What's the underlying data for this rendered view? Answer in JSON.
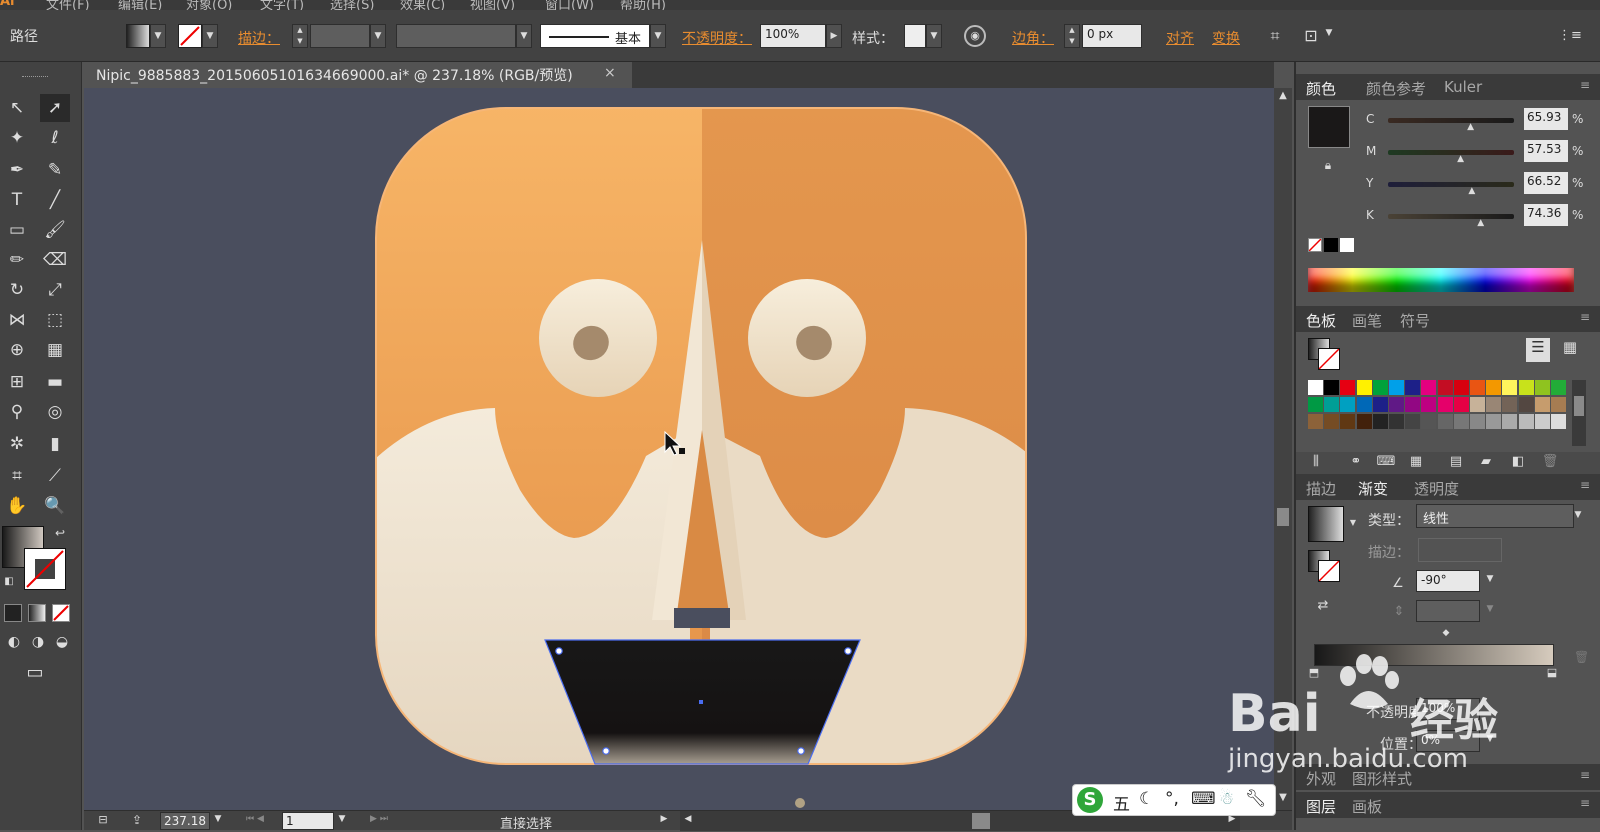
{
  "menu": {
    "items": [
      "文件(F)",
      "编辑(E)",
      "对象(O)",
      "文字(T)",
      "选择(S)",
      "效果(C)",
      "视图(V)",
      "窗口(W)",
      "帮助(H)"
    ]
  },
  "control_bar": {
    "object_type": "路径",
    "stroke_label": "描边：",
    "stroke_profile": "基本",
    "opacity_label": "不透明度：",
    "opacity_value": "100%",
    "style_label": "样式：",
    "corner_label": "边角：",
    "corner_value": "0 px",
    "align_label": "对齐",
    "transform_label": "变换"
  },
  "document": {
    "tab_title": "Nipic_9885883_20150605101634669000.ai* @ 237.18% (RGB/预览)",
    "close_glyph": "×"
  },
  "status_bar": {
    "zoom": "237.18",
    "page": "1",
    "tool_name": "直接选择"
  },
  "color_panel": {
    "tabs": [
      "颜色",
      "颜色参考",
      "Kuler"
    ],
    "channels": [
      {
        "label": "C",
        "value": "65.93",
        "unit": "%",
        "level": 0.66
      },
      {
        "label": "M",
        "value": "57.53",
        "unit": "%",
        "level": 0.58
      },
      {
        "label": "Y",
        "value": "66.52",
        "unit": "%",
        "level": 0.67
      },
      {
        "label": "K",
        "value": "74.36",
        "unit": "%",
        "level": 0.74
      }
    ]
  },
  "swatch_panel": {
    "tabs": [
      "色板",
      "画笔",
      "符号"
    ]
  },
  "gradient_panel": {
    "tabs": [
      "描边",
      "渐变",
      "透明度"
    ],
    "type_label": "类型：",
    "type_value": "线性",
    "stroke_label": "描边：",
    "angle_value": "-90°",
    "opacity_label": "不透明度：",
    "opacity_value": "100%",
    "location_label": "位置：",
    "location_value": "0%"
  },
  "appearance_panel": {
    "tabs": [
      "外观",
      "图形样式"
    ]
  },
  "layers_panel": {
    "tabs": [
      "图层",
      "画板"
    ]
  },
  "watermark": {
    "brand": "Bai",
    "brand_cn": "经验",
    "url": "jingyan.baidu.com"
  },
  "ime_bar": {
    "mode": "五"
  },
  "colors": {
    "accent_orange": "#e88c2f",
    "ui_dark": "#424242",
    "canvas_bg": "#4a4e5e",
    "selection_blue": "#4a6cf0"
  }
}
